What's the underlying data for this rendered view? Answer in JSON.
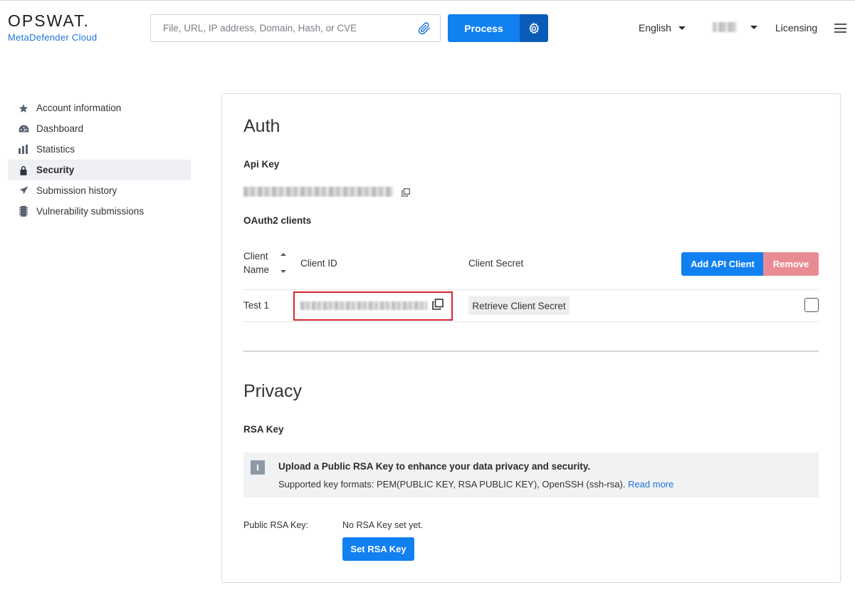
{
  "header": {
    "logo_text": "OPSWAT.",
    "logo_subtitle": "MetaDefender Cloud",
    "search_placeholder": "File, URL, IP address, Domain, Hash, or CVE",
    "process_label": "Process",
    "language": "English",
    "licensing_label": "Licensing"
  },
  "sidebar": {
    "items": [
      {
        "label": "Account information",
        "icon": "star-icon"
      },
      {
        "label": "Dashboard",
        "icon": "dashboard-icon"
      },
      {
        "label": "Statistics",
        "icon": "bar-chart-icon"
      },
      {
        "label": "Security",
        "icon": "lock-icon",
        "active": true
      },
      {
        "label": "Submission history",
        "icon": "paper-plane-icon"
      },
      {
        "label": "Vulnerability submissions",
        "icon": "chip-icon"
      }
    ]
  },
  "auth": {
    "heading": "Auth",
    "api_key_label": "Api Key",
    "oauth_label": "OAuth2 clients",
    "columns": {
      "client_name_line1": "Client",
      "client_name_line2": "Name",
      "client_id": "Client ID",
      "client_secret": "Client Secret"
    },
    "add_button": "Add API Client",
    "remove_button": "Remove",
    "rows": [
      {
        "name": "Test 1",
        "secret_button": "Retrieve Client Secret"
      }
    ]
  },
  "privacy": {
    "heading": "Privacy",
    "rsa_label": "RSA Key",
    "info_title": "Upload a Public RSA Key to enhance your data privacy and security.",
    "info_sub": "Supported key formats: PEM(PUBLIC KEY, RSA PUBLIC KEY), OpenSSH (ssh-rsa). ",
    "info_link": "Read more",
    "public_key_label": "Public RSA Key:",
    "public_key_value": "No RSA Key set yet.",
    "set_button": "Set RSA Key"
  },
  "colors": {
    "primary": "#1180f0",
    "primary_dark": "#0b5cb8",
    "danger": "#e98b93",
    "highlight": "#d8262c",
    "link": "#1a73d9"
  }
}
